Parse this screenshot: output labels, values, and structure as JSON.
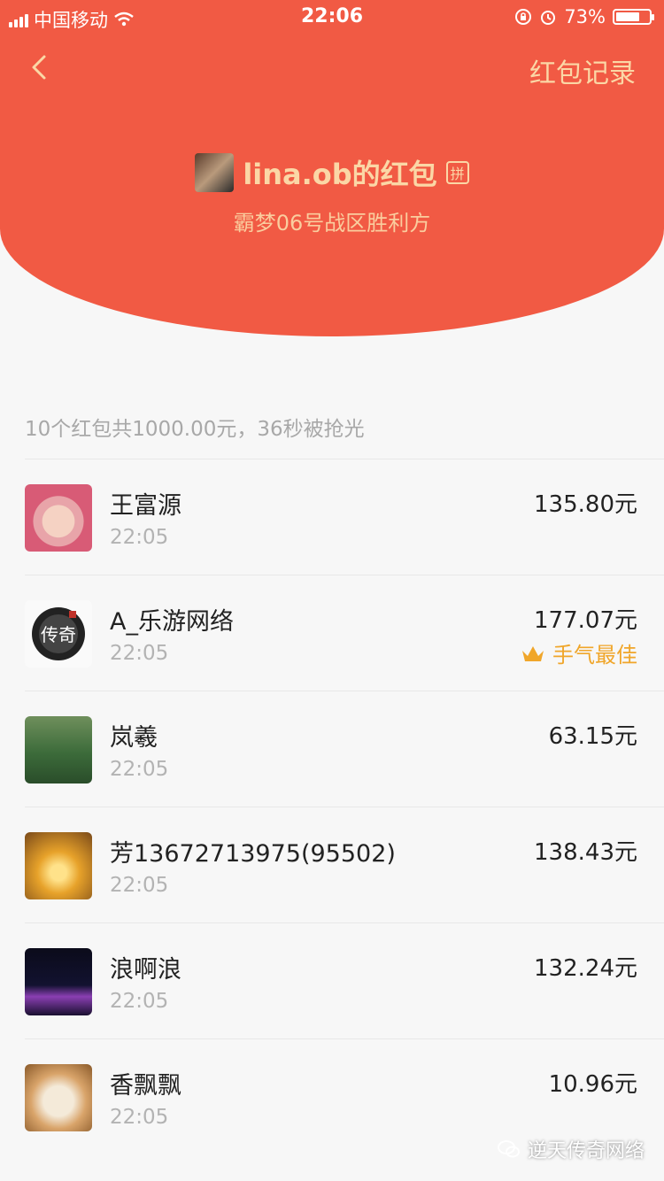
{
  "status_bar": {
    "carrier": "中国移动",
    "time": "22:06",
    "battery": "73%",
    "battery_level": 0.73
  },
  "header": {
    "records_link": "红包记录",
    "owner_title": "lina.ob的红包",
    "badge": "拼",
    "greeting": "霸梦06号战区胜利方",
    "colors": {
      "background": "#f15a44",
      "accent": "#fbd7a6"
    }
  },
  "summary": "10个红包共1000.00元，36秒被抢光",
  "recipients": [
    {
      "name": "王富源",
      "time": "22:05",
      "amount": "135.80元"
    },
    {
      "name": "A_乐游网络",
      "time": "22:05",
      "amount": "177.07元",
      "best_label": "手气最佳",
      "best_icon": "crown-icon"
    },
    {
      "name": "岚羲",
      "time": "22:05",
      "amount": "63.15元"
    },
    {
      "name": "芳13672713975(95502)",
      "time": "22:05",
      "amount": "138.43元"
    },
    {
      "name": "浪啊浪",
      "time": "22:05",
      "amount": "132.24元"
    },
    {
      "name": "香飘飘",
      "time": "22:05",
      "amount": "10.96元"
    }
  ],
  "watermark": "逆天传奇网络",
  "avatar_logo_text": "传奇"
}
